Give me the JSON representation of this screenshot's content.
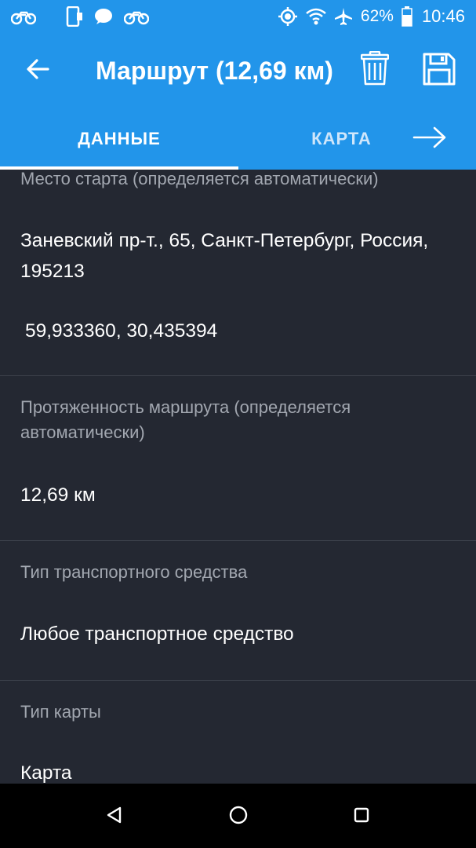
{
  "status_bar": {
    "battery_percent": "62%",
    "time": "10:46",
    "left_icons": [
      "motorcycle-icon",
      "phone-notification-icon",
      "message-icon",
      "motorcycle-icon"
    ],
    "right_icons": [
      "gps-icon",
      "wifi-icon",
      "airplane-icon",
      "battery-icon"
    ]
  },
  "app_bar": {
    "title": "Маршрут (12,69 км)",
    "back_icon": "arrow-back-icon",
    "delete_icon": "trash-icon",
    "save_icon": "save-icon"
  },
  "tabs": [
    {
      "label": "ДАННЫЕ",
      "selected": true
    },
    {
      "label": "КАРТА",
      "selected": false
    }
  ],
  "sections": {
    "start": {
      "label": "Место старта (определяется автоматически)",
      "address": "Заневский пр-т., 65, Санкт-Петербург, Россия, 195213",
      "coords": "59,933360, 30,435394"
    },
    "length": {
      "label": "Протяженность маршрута (определяется автоматически)",
      "value": "12,69 км"
    },
    "vehicle": {
      "label": "Тип транспортного средства",
      "value": "Любое транспортное средство"
    },
    "map_type": {
      "label": "Тип карты",
      "value": "Карта"
    }
  },
  "colors": {
    "accent": "#2295ea",
    "background": "#242832",
    "label": "#a2a7b0",
    "divider": "#3c414b"
  }
}
